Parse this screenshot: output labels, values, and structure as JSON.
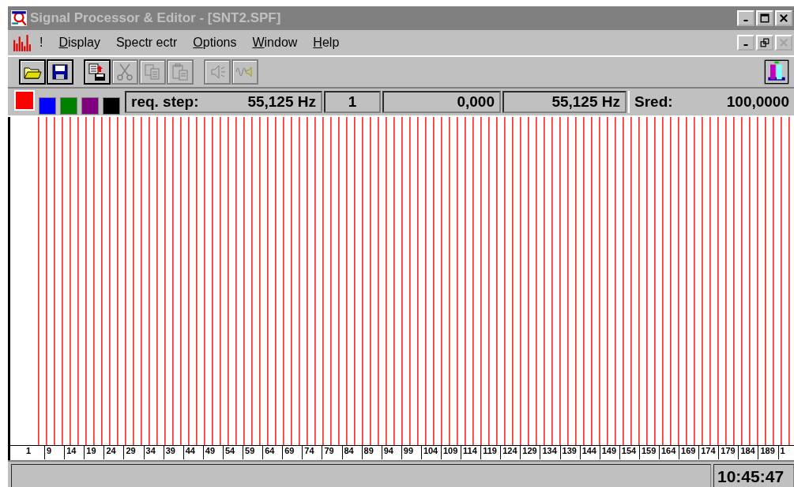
{
  "window": {
    "title": "Signal Processor & Editor - [SNT2.SPF]",
    "active": false
  },
  "menu": [
    {
      "label": "!",
      "first_letter_underlined": false
    },
    {
      "label": "Display",
      "first_letter_underlined": true
    },
    {
      "label": "Spectr ectr",
      "first_letter_underlined": false
    },
    {
      "label": "Options",
      "first_letter_underlined": true
    },
    {
      "label": "Window",
      "first_letter_underlined": true
    },
    {
      "label": "Help",
      "first_letter_underlined": true
    }
  ],
  "toolbar": [
    {
      "kind": "open",
      "disabled": false
    },
    {
      "kind": "save",
      "disabled": false
    },
    {
      "kind": "gap"
    },
    {
      "kind": "export",
      "disabled": false
    },
    {
      "kind": "cut",
      "disabled": true
    },
    {
      "kind": "copy",
      "disabled": true
    },
    {
      "kind": "paste",
      "disabled": true
    },
    {
      "kind": "gap"
    },
    {
      "kind": "speaker",
      "disabled": true
    },
    {
      "kind": "wave",
      "disabled": true
    }
  ],
  "colors": [
    {
      "color": "#ff0000",
      "selected": true
    },
    {
      "color": "#0000ff",
      "selected": false
    },
    {
      "color": "#008000",
      "selected": false
    },
    {
      "color": "#800080",
      "selected": false
    },
    {
      "color": "#000000",
      "selected": false
    }
  ],
  "info": {
    "step_label": "req. step:",
    "step_value": "55,125 Hz",
    "index": "1",
    "amplitude": "0,000",
    "frequency": "55,125 Hz",
    "sred_label": "Sred:",
    "sred_value": "100,0000"
  },
  "axis_labels": [
    "1",
    "9",
    "14",
    "19",
    "24",
    "29",
    "34",
    "39",
    "44",
    "49",
    "54",
    "59",
    "64",
    "69",
    "74",
    "79",
    "84",
    "89",
    "94",
    "99",
    "104",
    "109",
    "114",
    "119",
    "124",
    "129",
    "134",
    "139",
    "144",
    "149",
    "154",
    "159",
    "164",
    "169",
    "174",
    "179",
    "184",
    "189",
    "1"
  ],
  "status_bar": {
    "time": "10:45:47"
  }
}
